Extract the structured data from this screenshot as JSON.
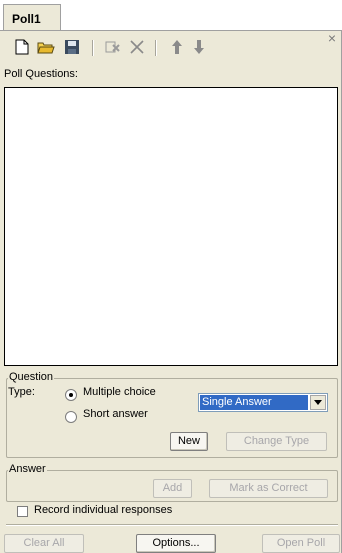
{
  "tab": {
    "label": "Poll1"
  },
  "toolbar": {
    "icons": [
      "new-document-icon",
      "open-folder-icon",
      "save-icon",
      "clear-icon",
      "delete-icon",
      "move-up-icon",
      "move-down-icon"
    ],
    "close_label": "×"
  },
  "questions": {
    "label": "Poll Questions:"
  },
  "question_group": {
    "legend": "Question",
    "type_label": "Type:",
    "multiple_choice_label": "Multiple choice",
    "short_answer_label": "Short answer",
    "selected_type": "Multiple choice",
    "answer_mode_value": "Single  Answer",
    "new_label": "New",
    "change_type_label": "Change Type"
  },
  "answer_group": {
    "legend": "Answer",
    "add_label": "Add",
    "mark_correct_label": "Mark as Correct"
  },
  "record_responses_label": "Record individual responses",
  "footer": {
    "clear_all_label": "Clear All",
    "options_label": "Options...",
    "open_poll_label": "Open Poll"
  },
  "colors": {
    "panel": "#ece9d8",
    "selection": "#316ac5",
    "disabled_text": "#a7a6aa"
  }
}
